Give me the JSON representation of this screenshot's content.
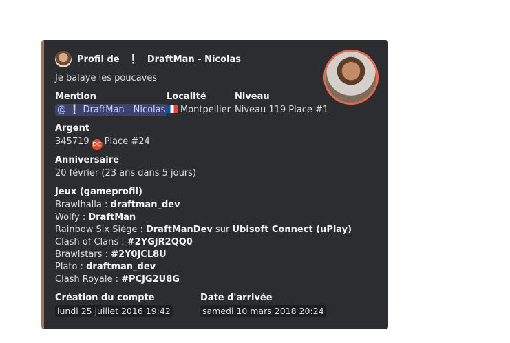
{
  "embed": {
    "author": {
      "prefix": "Profil de",
      "excl": "❕",
      "name": "DraftMan - Nicolas"
    },
    "description": "Je balaye les poucaves",
    "fields": {
      "mention": {
        "name": "Mention",
        "value_prefix": "@",
        "excl": "❕",
        "value": "DraftMan - Nicolas"
      },
      "localite": {
        "name": "Localité",
        "value": "Montpellier"
      },
      "niveau": {
        "name": "Niveau",
        "value": "Niveau 119 Place #1"
      },
      "argent": {
        "name": "Argent",
        "amount": "345719",
        "coin_label": "DC",
        "place": "Place #24"
      },
      "anniversaire": {
        "name": "Anniversaire",
        "value": "20 février (23 ans dans 5 jours)"
      },
      "jeux": {
        "name": "Jeux (gameprofil)",
        "lines": [
          {
            "game": "Brawlhalla : ",
            "id": "draftman_dev"
          },
          {
            "game": "Wolfy : ",
            "id": "DraftMan"
          },
          {
            "game": "Rainbow Six Siège : ",
            "id": "DraftManDev",
            "sep": " sur ",
            "platform": "Ubisoft Connect (uPlay)"
          },
          {
            "game": "Clash of Clans : ",
            "id": "#2YGJR2QQ0"
          },
          {
            "game": "Brawlstars : ",
            "id": "#2Y0JCL8U"
          },
          {
            "game": "Plato : ",
            "id": "draftman_dev"
          },
          {
            "game": "Clash Royale : ",
            "id": "#PCJG2U8G"
          }
        ]
      },
      "creation": {
        "name": "Création du compte",
        "value": "lundi 25 juillet 2016 19:42"
      },
      "arrivee": {
        "name": "Date d'arrivée",
        "value": "samedi 10 mars 2018 20:24"
      }
    },
    "accent_color": "#a0755a"
  }
}
